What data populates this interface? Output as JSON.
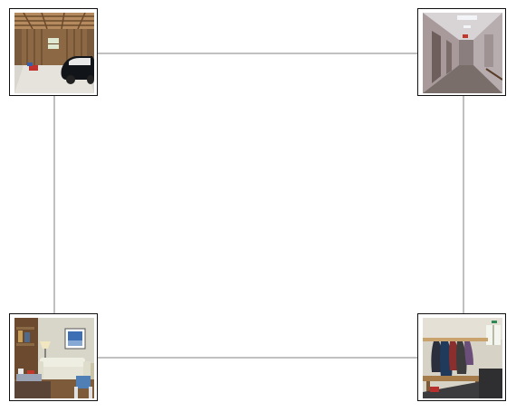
{
  "diagram": {
    "edge_color": "#808080",
    "frame_border_color": "#111111",
    "nodes": [
      {
        "id": "node-tl",
        "picture": "garage-interior-photo"
      },
      {
        "id": "node-tr",
        "picture": "hallway-corridor-photo"
      },
      {
        "id": "node-bl",
        "picture": "living-room-photo"
      },
      {
        "id": "node-br",
        "picture": "coat-rack-entryway-photo"
      }
    ],
    "edges": [
      [
        "node-tl",
        "node-tr"
      ],
      [
        "node-tl",
        "node-bl"
      ],
      [
        "node-tr",
        "node-br"
      ],
      [
        "node-bl",
        "node-br"
      ]
    ]
  }
}
